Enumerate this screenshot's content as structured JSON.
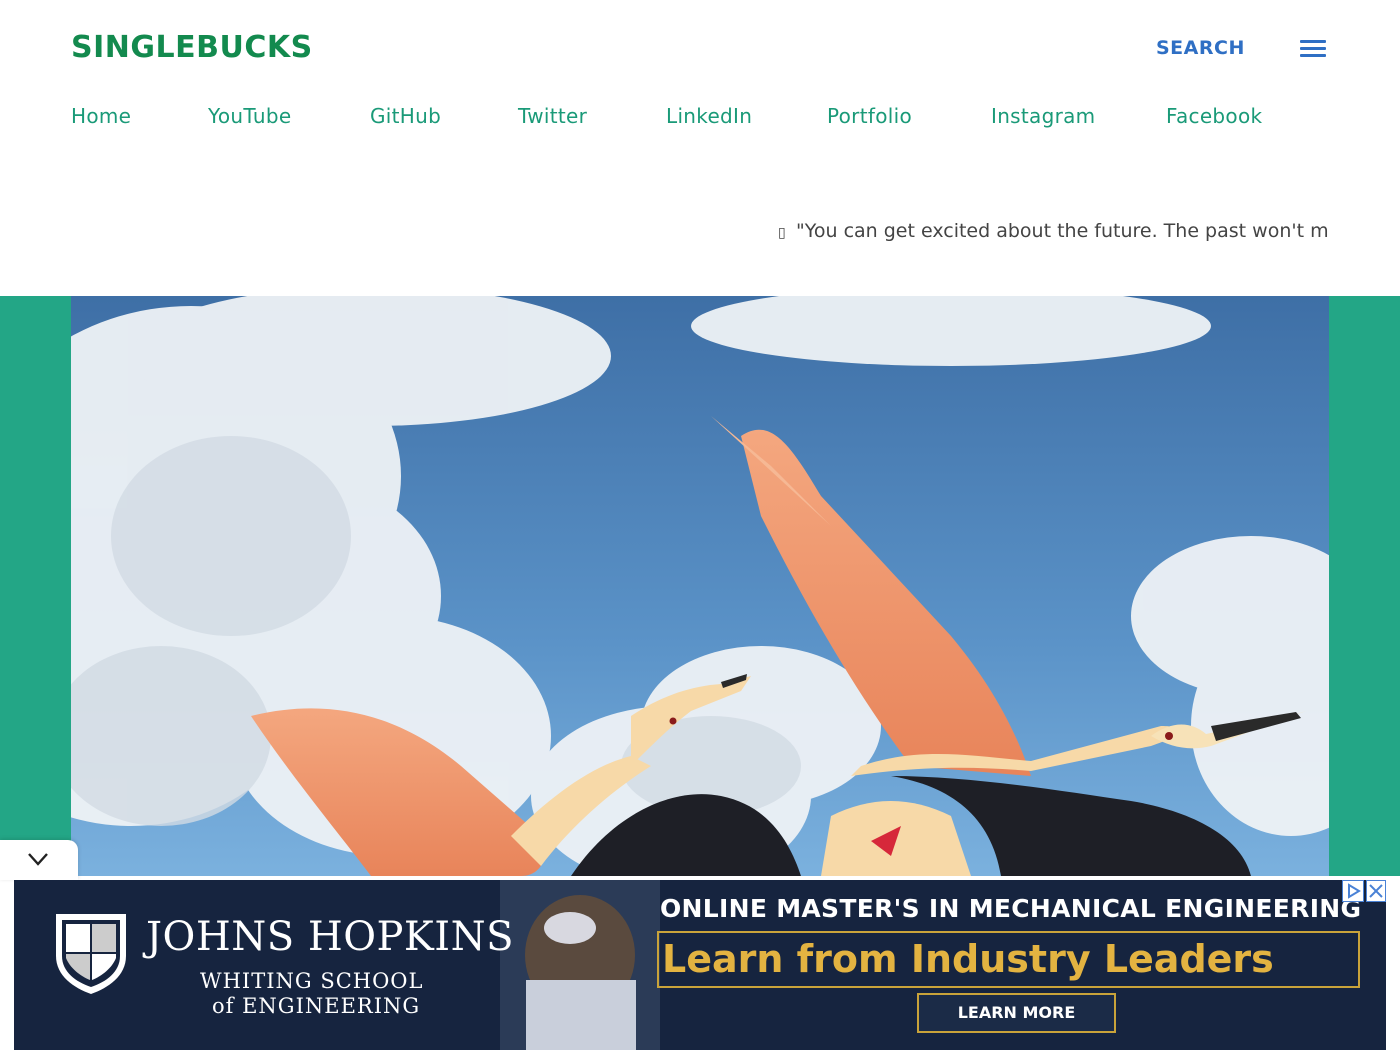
{
  "site": {
    "logo": "SINGLEBUCKS",
    "search_label": "SEARCH",
    "menu_icon": "hamburger-menu-icon"
  },
  "nav": {
    "items": [
      {
        "label": "Home"
      },
      {
        "label": "YouTube"
      },
      {
        "label": "GitHub"
      },
      {
        "label": "Twitter"
      },
      {
        "label": "LinkedIn"
      },
      {
        "label": "Portfolio"
      },
      {
        "label": "Instagram"
      },
      {
        "label": "Facebook"
      }
    ]
  },
  "ticker": {
    "icon": "quote-icon",
    "text": "\"You can get excited about the future. The past won't mi"
  },
  "hero": {
    "image": "flying-spoonbills-photo"
  },
  "ad": {
    "org": "JOHNS HOPKINS",
    "school_line1": "WHITING SCHOOL",
    "school_line2": "of ENGINEERING",
    "headline": "ONLINE MASTER'S IN MECHANICAL ENGINEERING",
    "tagline": "Learn from Industry Leaders",
    "cta": "LEARN MORE"
  },
  "colors": {
    "brand_green": "#138a4e",
    "nav_green": "#1a9a78",
    "hero_band": "#23a686",
    "search_blue": "#2f6fc4",
    "ad_navy": "#16243f",
    "ad_gold": "#e3b341"
  }
}
